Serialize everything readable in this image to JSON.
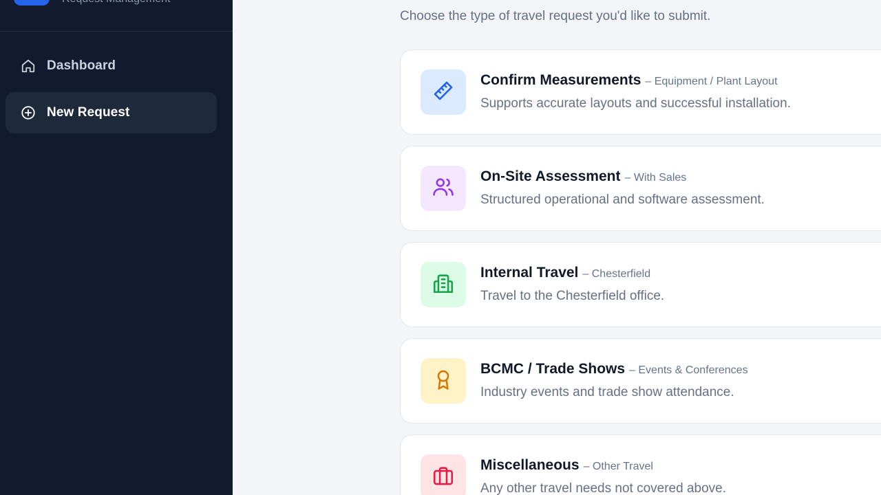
{
  "brand": {
    "subtitle": "Request Management"
  },
  "nav": {
    "items": [
      {
        "label": "Dashboard",
        "icon": "home-icon"
      },
      {
        "label": "New Request",
        "icon": "plus-circle-icon"
      }
    ]
  },
  "main": {
    "subtitle": "Choose the type of travel request you'd like to submit."
  },
  "cards": [
    {
      "title": "Confirm Measurements",
      "tag": "– Equipment / Plant Layout",
      "desc": "Supports accurate layouts and successful installation.",
      "icon": "ruler-icon",
      "icon_color": "#2563eb",
      "icon_bg": "#dbeafe"
    },
    {
      "title": "On-Site Assessment",
      "tag": "– With Sales",
      "desc": "Structured operational and software assessment.",
      "icon": "users-icon",
      "icon_color": "#9333ea",
      "icon_bg": "#f3e8ff"
    },
    {
      "title": "Internal Travel",
      "tag": "– Chesterfield",
      "desc": "Travel to the Chesterfield office.",
      "icon": "building-icon",
      "icon_color": "#16a34a",
      "icon_bg": "#dcfce7"
    },
    {
      "title": "BCMC / Trade Shows",
      "tag": "– Events & Conferences",
      "desc": "Industry events and trade show attendance.",
      "icon": "award-icon",
      "icon_color": "#d97706",
      "icon_bg": "#fef3c7"
    },
    {
      "title": "Miscellaneous",
      "tag": "– Other Travel",
      "desc": "Any other travel needs not covered above.",
      "icon": "briefcase-icon",
      "icon_color": "#e11d48",
      "icon_bg": "#ffe4e6"
    }
  ]
}
